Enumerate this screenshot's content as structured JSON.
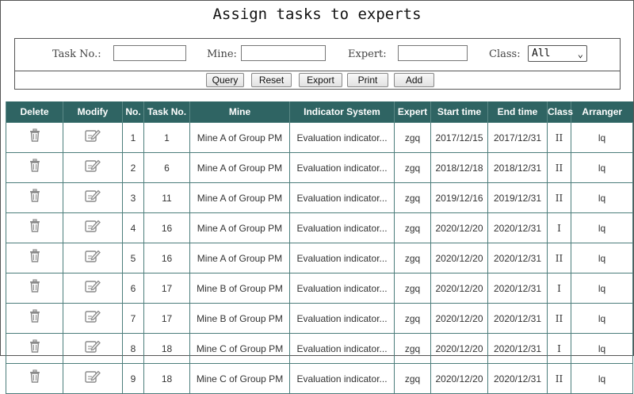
{
  "page": {
    "title": "Assign tasks to experts"
  },
  "filters": {
    "task_no_label": "Task No.:",
    "mine_label": "Mine:",
    "expert_label": "Expert:",
    "class_label": "Class:",
    "task_no_value": "",
    "mine_value": "",
    "expert_value": "",
    "class_selected": "All"
  },
  "actions": {
    "query": "Query",
    "reset": "Reset",
    "export": "Export",
    "print": "Print",
    "add": "Add"
  },
  "table": {
    "headers": {
      "delete": "Delete",
      "modify": "Modify",
      "no": "No.",
      "task_no": "Task No.",
      "mine": "Mine",
      "indicator": "Indicator System",
      "expert": "Expert",
      "start": "Start time",
      "end": "End time",
      "class": "Class",
      "arranger": "Arranger"
    },
    "rows": [
      {
        "no": "1",
        "task_no": "1",
        "mine": "Mine A of Group PM",
        "indicator": "Evaluation indicator...",
        "expert": "zgq",
        "start": "2017/12/15",
        "end": "2017/12/31",
        "class": "II",
        "arranger": "lq"
      },
      {
        "no": "2",
        "task_no": "6",
        "mine": "Mine A of Group PM",
        "indicator": "Evaluation indicator...",
        "expert": "zgq",
        "start": "2018/12/18",
        "end": "2018/12/31",
        "class": "II",
        "arranger": "lq"
      },
      {
        "no": "3",
        "task_no": "11",
        "mine": "Mine A of Group PM",
        "indicator": "Evaluation indicator...",
        "expert": "zgq",
        "start": "2019/12/16",
        "end": "2019/12/31",
        "class": "II",
        "arranger": "lq"
      },
      {
        "no": "4",
        "task_no": "16",
        "mine": "Mine A of Group PM",
        "indicator": "Evaluation indicator...",
        "expert": "zgq",
        "start": "2020/12/20",
        "end": "2020/12/31",
        "class": "I",
        "arranger": "lq"
      },
      {
        "no": "5",
        "task_no": "16",
        "mine": "Mine A of Group PM",
        "indicator": "Evaluation indicator...",
        "expert": "zgq",
        "start": "2020/12/20",
        "end": "2020/12/31",
        "class": "II",
        "arranger": "lq"
      },
      {
        "no": "6",
        "task_no": "17",
        "mine": "Mine B of Group PM",
        "indicator": "Evaluation indicator...",
        "expert": "zgq",
        "start": "2020/12/20",
        "end": "2020/12/31",
        "class": "I",
        "arranger": "lq"
      },
      {
        "no": "7",
        "task_no": "17",
        "mine": "Mine B of Group PM",
        "indicator": "Evaluation indicator...",
        "expert": "zgq",
        "start": "2020/12/20",
        "end": "2020/12/31",
        "class": "II",
        "arranger": "lq"
      },
      {
        "no": "8",
        "task_no": "18",
        "mine": "Mine C of Group PM",
        "indicator": "Evaluation indicator...",
        "expert": "zgq",
        "start": "2020/12/20",
        "end": "2020/12/31",
        "class": "I",
        "arranger": "lq"
      },
      {
        "no": "9",
        "task_no": "18",
        "mine": "Mine C of Group PM",
        "indicator": "Evaluation indicator...",
        "expert": "zgq",
        "start": "2020/12/20",
        "end": "2020/12/31",
        "class": "II",
        "arranger": "lq"
      }
    ]
  },
  "icons": {
    "delete": "trash-icon",
    "modify": "edit-icon"
  },
  "colors": {
    "header_bg": "#2f6463",
    "border": "#4c7d7b"
  }
}
